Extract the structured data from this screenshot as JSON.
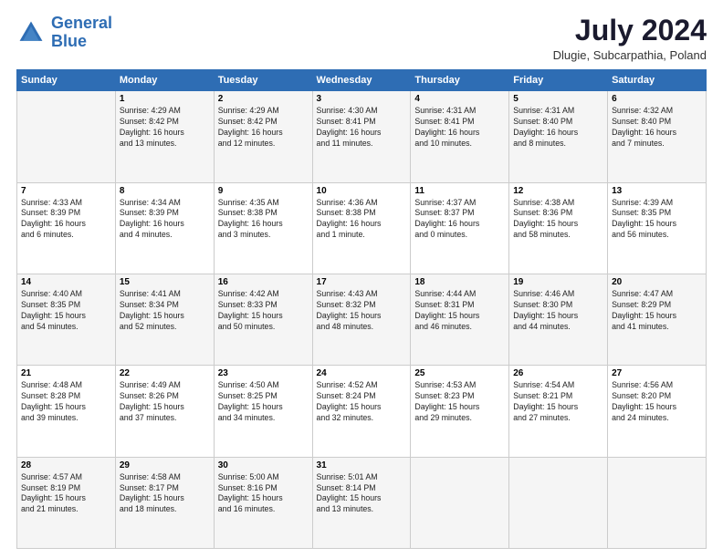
{
  "header": {
    "logo_line1": "General",
    "logo_line2": "Blue",
    "month_year": "July 2024",
    "location": "Dlugie, Subcarpathia, Poland"
  },
  "weekdays": [
    "Sunday",
    "Monday",
    "Tuesday",
    "Wednesday",
    "Thursday",
    "Friday",
    "Saturday"
  ],
  "weeks": [
    [
      {
        "day": "",
        "text": ""
      },
      {
        "day": "1",
        "text": "Sunrise: 4:29 AM\nSunset: 8:42 PM\nDaylight: 16 hours\nand 13 minutes."
      },
      {
        "day": "2",
        "text": "Sunrise: 4:29 AM\nSunset: 8:42 PM\nDaylight: 16 hours\nand 12 minutes."
      },
      {
        "day": "3",
        "text": "Sunrise: 4:30 AM\nSunset: 8:41 PM\nDaylight: 16 hours\nand 11 minutes."
      },
      {
        "day": "4",
        "text": "Sunrise: 4:31 AM\nSunset: 8:41 PM\nDaylight: 16 hours\nand 10 minutes."
      },
      {
        "day": "5",
        "text": "Sunrise: 4:31 AM\nSunset: 8:40 PM\nDaylight: 16 hours\nand 8 minutes."
      },
      {
        "day": "6",
        "text": "Sunrise: 4:32 AM\nSunset: 8:40 PM\nDaylight: 16 hours\nand 7 minutes."
      }
    ],
    [
      {
        "day": "7",
        "text": "Sunrise: 4:33 AM\nSunset: 8:39 PM\nDaylight: 16 hours\nand 6 minutes."
      },
      {
        "day": "8",
        "text": "Sunrise: 4:34 AM\nSunset: 8:39 PM\nDaylight: 16 hours\nand 4 minutes."
      },
      {
        "day": "9",
        "text": "Sunrise: 4:35 AM\nSunset: 8:38 PM\nDaylight: 16 hours\nand 3 minutes."
      },
      {
        "day": "10",
        "text": "Sunrise: 4:36 AM\nSunset: 8:38 PM\nDaylight: 16 hours\nand 1 minute."
      },
      {
        "day": "11",
        "text": "Sunrise: 4:37 AM\nSunset: 8:37 PM\nDaylight: 16 hours\nand 0 minutes."
      },
      {
        "day": "12",
        "text": "Sunrise: 4:38 AM\nSunset: 8:36 PM\nDaylight: 15 hours\nand 58 minutes."
      },
      {
        "day": "13",
        "text": "Sunrise: 4:39 AM\nSunset: 8:35 PM\nDaylight: 15 hours\nand 56 minutes."
      }
    ],
    [
      {
        "day": "14",
        "text": "Sunrise: 4:40 AM\nSunset: 8:35 PM\nDaylight: 15 hours\nand 54 minutes."
      },
      {
        "day": "15",
        "text": "Sunrise: 4:41 AM\nSunset: 8:34 PM\nDaylight: 15 hours\nand 52 minutes."
      },
      {
        "day": "16",
        "text": "Sunrise: 4:42 AM\nSunset: 8:33 PM\nDaylight: 15 hours\nand 50 minutes."
      },
      {
        "day": "17",
        "text": "Sunrise: 4:43 AM\nSunset: 8:32 PM\nDaylight: 15 hours\nand 48 minutes."
      },
      {
        "day": "18",
        "text": "Sunrise: 4:44 AM\nSunset: 8:31 PM\nDaylight: 15 hours\nand 46 minutes."
      },
      {
        "day": "19",
        "text": "Sunrise: 4:46 AM\nSunset: 8:30 PM\nDaylight: 15 hours\nand 44 minutes."
      },
      {
        "day": "20",
        "text": "Sunrise: 4:47 AM\nSunset: 8:29 PM\nDaylight: 15 hours\nand 41 minutes."
      }
    ],
    [
      {
        "day": "21",
        "text": "Sunrise: 4:48 AM\nSunset: 8:28 PM\nDaylight: 15 hours\nand 39 minutes."
      },
      {
        "day": "22",
        "text": "Sunrise: 4:49 AM\nSunset: 8:26 PM\nDaylight: 15 hours\nand 37 minutes."
      },
      {
        "day": "23",
        "text": "Sunrise: 4:50 AM\nSunset: 8:25 PM\nDaylight: 15 hours\nand 34 minutes."
      },
      {
        "day": "24",
        "text": "Sunrise: 4:52 AM\nSunset: 8:24 PM\nDaylight: 15 hours\nand 32 minutes."
      },
      {
        "day": "25",
        "text": "Sunrise: 4:53 AM\nSunset: 8:23 PM\nDaylight: 15 hours\nand 29 minutes."
      },
      {
        "day": "26",
        "text": "Sunrise: 4:54 AM\nSunset: 8:21 PM\nDaylight: 15 hours\nand 27 minutes."
      },
      {
        "day": "27",
        "text": "Sunrise: 4:56 AM\nSunset: 8:20 PM\nDaylight: 15 hours\nand 24 minutes."
      }
    ],
    [
      {
        "day": "28",
        "text": "Sunrise: 4:57 AM\nSunset: 8:19 PM\nDaylight: 15 hours\nand 21 minutes."
      },
      {
        "day": "29",
        "text": "Sunrise: 4:58 AM\nSunset: 8:17 PM\nDaylight: 15 hours\nand 18 minutes."
      },
      {
        "day": "30",
        "text": "Sunrise: 5:00 AM\nSunset: 8:16 PM\nDaylight: 15 hours\nand 16 minutes."
      },
      {
        "day": "31",
        "text": "Sunrise: 5:01 AM\nSunset: 8:14 PM\nDaylight: 15 hours\nand 13 minutes."
      },
      {
        "day": "",
        "text": ""
      },
      {
        "day": "",
        "text": ""
      },
      {
        "day": "",
        "text": ""
      }
    ]
  ]
}
